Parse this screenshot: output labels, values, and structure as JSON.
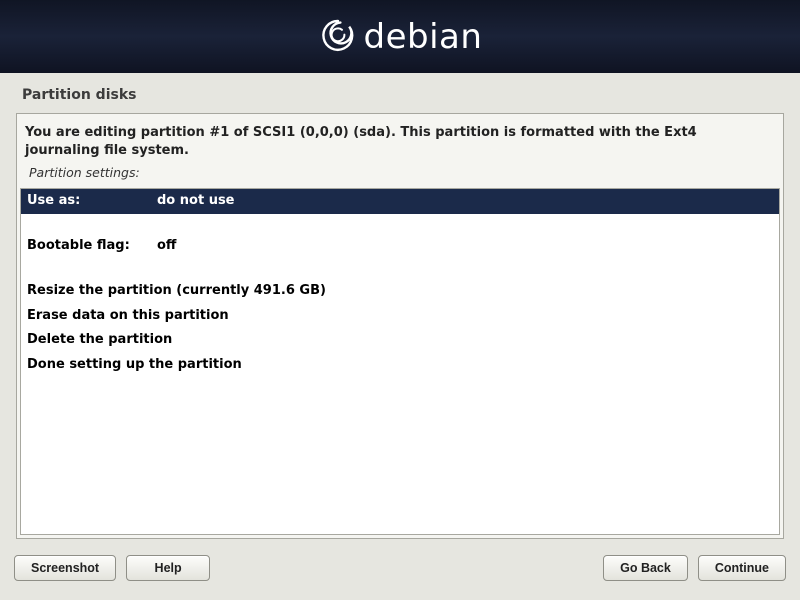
{
  "header": {
    "brand": "debian"
  },
  "page_title": "Partition disks",
  "instruction": "You are editing partition #1 of SCSI1 (0,0,0) (sda). This partition is formatted with the Ext4 journaling file system.",
  "subhead": "Partition settings:",
  "rows": {
    "use_as_key": "Use as:",
    "use_as_val": "do not use",
    "bootable_key": "Bootable flag:",
    "bootable_val": "off",
    "resize": "Resize the partition (currently 491.6 GB)",
    "erase": "Erase data on this partition",
    "delete": "Delete the partition",
    "done": "Done setting up the partition"
  },
  "buttons": {
    "screenshot": "Screenshot",
    "help": "Help",
    "goback": "Go Back",
    "continue": "Continue"
  }
}
